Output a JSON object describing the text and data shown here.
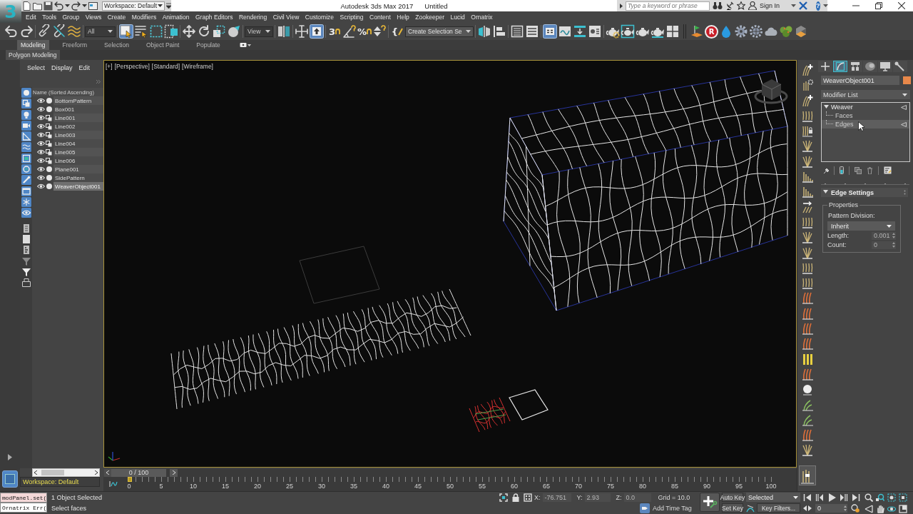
{
  "header": {
    "logo": "3",
    "workspace": "Workspace: Default",
    "app_title": "Autodesk 3ds Max 2017",
    "document": "Untitled",
    "search": {
      "placeholder": "Type a keyword or phrase"
    },
    "sign_in": "Sign In",
    "help": "?",
    "menu": [
      "Edit",
      "Tools",
      "Group",
      "Views",
      "Create",
      "Modifiers",
      "Animation",
      "Graph Editors",
      "Rendering",
      "Civil View",
      "Customize",
      "Scripting",
      "Content",
      "Help",
      "Zookeeper",
      "Lucid",
      "Ornatrix"
    ]
  },
  "main_toolbar": {
    "groups": [
      [
        {
          "kind": "undo",
          "active": false
        },
        {
          "kind": "redo",
          "active": false
        }
      ],
      [
        {
          "kind": "link",
          "active": false
        },
        {
          "kind": "unlink",
          "active": false
        },
        {
          "kind": "bind",
          "active": false
        }
      ],
      [
        {
          "kind": "filter-dropdown",
          "value": "All"
        }
      ],
      [
        {
          "kind": "select",
          "active": true
        },
        {
          "kind": "select-by-name",
          "active": false
        },
        {
          "kind": "region",
          "active": false
        },
        {
          "kind": "window-crossing",
          "active": false
        }
      ],
      [
        {
          "kind": "move",
          "active": false
        },
        {
          "kind": "rotate",
          "active": false
        },
        {
          "kind": "scale",
          "active": false
        },
        {
          "kind": "place",
          "active": false
        }
      ],
      [
        {
          "kind": "coordinate-dropdown",
          "value": "View"
        }
      ],
      [
        {
          "kind": "pivot",
          "active": false
        }
      ],
      [
        {
          "kind": "manipulate",
          "active": false
        },
        {
          "kind": "keyboard-override",
          "active": true
        }
      ],
      [
        {
          "kind": "snap",
          "label": "3",
          "active": false
        },
        {
          "kind": "angle-snap",
          "active": false
        },
        {
          "kind": "percent-snap",
          "label": "%",
          "active": false
        },
        {
          "kind": "spinner-snap",
          "active": false
        }
      ],
      [
        {
          "kind": "named-sets",
          "label": "{",
          "active": false
        },
        {
          "kind": "selection-set-field",
          "value": "Create Selection Se"
        }
      ],
      [
        {
          "kind": "mirror",
          "active": false
        },
        {
          "kind": "align",
          "active": false
        }
      ],
      [
        {
          "kind": "scene-explorer",
          "active": false
        },
        {
          "kind": "layer-explorer",
          "active": false
        }
      ],
      [
        {
          "kind": "ribbon",
          "active": true
        },
        {
          "kind": "curve-editor",
          "active": false
        },
        {
          "kind": "schematic",
          "active": false
        },
        {
          "kind": "material-editor",
          "active": false
        }
      ],
      [
        {
          "kind": "render-setup",
          "active": false
        },
        {
          "kind": "frame-window",
          "active": false
        },
        {
          "kind": "render",
          "active": false
        },
        {
          "kind": "active-shade",
          "active": false
        },
        {
          "kind": "quad",
          "active": false
        }
      ],
      [
        {
          "kind": "render-flag",
          "active": false
        },
        {
          "kind": "letter-badge",
          "label": "R",
          "active": false
        },
        {
          "kind": "drop",
          "active": false
        },
        {
          "kind": "gear",
          "active": false
        },
        {
          "kind": "gear-globe",
          "active": false
        },
        {
          "kind": "cloud",
          "active": false
        },
        {
          "kind": "plant",
          "active": false
        },
        {
          "kind": "cube",
          "active": false
        }
      ]
    ]
  },
  "ribbon": {
    "tabs": [
      {
        "label": "Modeling",
        "selected": true
      },
      {
        "label": "Freeform",
        "selected": false
      },
      {
        "label": "Selection",
        "selected": false
      },
      {
        "label": "Object Paint",
        "selected": false
      },
      {
        "label": "Populate",
        "selected": false
      }
    ],
    "panel": "Polygon Modeling"
  },
  "scene_explorer": {
    "menu": [
      "Select",
      "Display",
      "Edit"
    ],
    "filters": [
      {
        "kind": "geometry",
        "on": true
      },
      {
        "kind": "shapes",
        "on": true
      },
      {
        "kind": "lights",
        "on": true
      },
      {
        "kind": "cameras",
        "on": true
      },
      {
        "kind": "helpers",
        "on": true
      },
      {
        "kind": "space-warps",
        "on": true
      },
      {
        "kind": "groups",
        "on": true
      },
      {
        "kind": "xrefs",
        "on": true
      },
      {
        "kind": "bones",
        "on": true
      },
      {
        "kind": "containers",
        "on": true
      },
      {
        "kind": "frozen",
        "on": true
      },
      {
        "kind": "hidden",
        "on": true
      }
    ],
    "column_header": "Name (Sorted Ascending)",
    "items": [
      {
        "name": "BottomPattern",
        "kind": "geometry",
        "visible": true,
        "selected": false
      },
      {
        "name": "Box001",
        "kind": "geometry",
        "visible": true,
        "selected": false
      },
      {
        "name": "Line001",
        "kind": "shape",
        "visible": true,
        "selected": false
      },
      {
        "name": "Line002",
        "kind": "shape",
        "visible": true,
        "selected": false
      },
      {
        "name": "Line003",
        "kind": "shape",
        "visible": true,
        "selected": false
      },
      {
        "name": "Line004",
        "kind": "shape",
        "visible": true,
        "selected": false
      },
      {
        "name": "Line005",
        "kind": "shape",
        "visible": true,
        "selected": false
      },
      {
        "name": "Line006",
        "kind": "shape",
        "visible": true,
        "selected": false
      },
      {
        "name": "Plane001",
        "kind": "geometry",
        "visible": true,
        "selected": false
      },
      {
        "name": "SidePattern",
        "kind": "geometry",
        "visible": true,
        "selected": false
      },
      {
        "name": "WeaverObject001",
        "kind": "geometry",
        "visible": true,
        "selected": true
      }
    ],
    "workspace": "Workspace: Default"
  },
  "viewport": {
    "labels": [
      "[+]",
      "[Perspective]",
      "[Standard]",
      "[Wireframe]"
    ]
  },
  "timeline": {
    "position": "0 / 100",
    "level": 0,
    "frames": [
      "0",
      "5",
      "10",
      "15",
      "20",
      "25",
      "30",
      "35",
      "40",
      "45",
      "50",
      "55",
      "60",
      "65",
      "70",
      "75",
      "80",
      "85",
      "90",
      "95",
      "100"
    ]
  },
  "command_panel": {
    "tabs": [
      {
        "kind": "create",
        "selected": false
      },
      {
        "kind": "modify",
        "selected": true
      },
      {
        "kind": "hierarchy",
        "selected": false
      },
      {
        "kind": "motion",
        "selected": false
      },
      {
        "kind": "display",
        "selected": false
      },
      {
        "kind": "utilities",
        "selected": false
      }
    ],
    "object_name": "WeaverObject001",
    "modifier_list": "Modifier List",
    "modifier_stack": [
      {
        "label": "Weaver",
        "expanded": true,
        "active": true,
        "selected": false,
        "children": [
          {
            "label": "Faces",
            "active": false,
            "selected": false
          },
          {
            "label": "Edges",
            "active": true,
            "selected": true
          }
        ]
      }
    ],
    "rollout": {
      "title": "Edge Settings",
      "expanded": true,
      "group": "Properties",
      "pattern_label": "Pattern Division:",
      "pattern_value": "Inherit",
      "spinners": [
        {
          "label": "Length:",
          "value": "0.001",
          "disabled": true
        },
        {
          "label": "Count:",
          "value": "0",
          "disabled": true
        }
      ]
    }
  },
  "status_bar": {
    "listener": [
      {
        "kind": "macro",
        "text": "modPanel.set("
      },
      {
        "kind": "output",
        "text": "Ornatrix Err("
      }
    ],
    "selection": "1 Object Selected",
    "prompt": "Select faces",
    "coordinates": [
      {
        "label": "X:",
        "value": "-76.751",
        "disabled": true
      },
      {
        "label": "Y:",
        "value": "2.93",
        "disabled": true
      },
      {
        "label": "Z:",
        "value": "0.0",
        "disabled": true
      }
    ],
    "grid": "Grid = 10.0",
    "time_tag": "Add Time Tag",
    "auto_key": "Auto Key",
    "set_key": "Set Key",
    "key_mode": "Selected",
    "key_filters": "Key Filters...",
    "frame": "0"
  }
}
